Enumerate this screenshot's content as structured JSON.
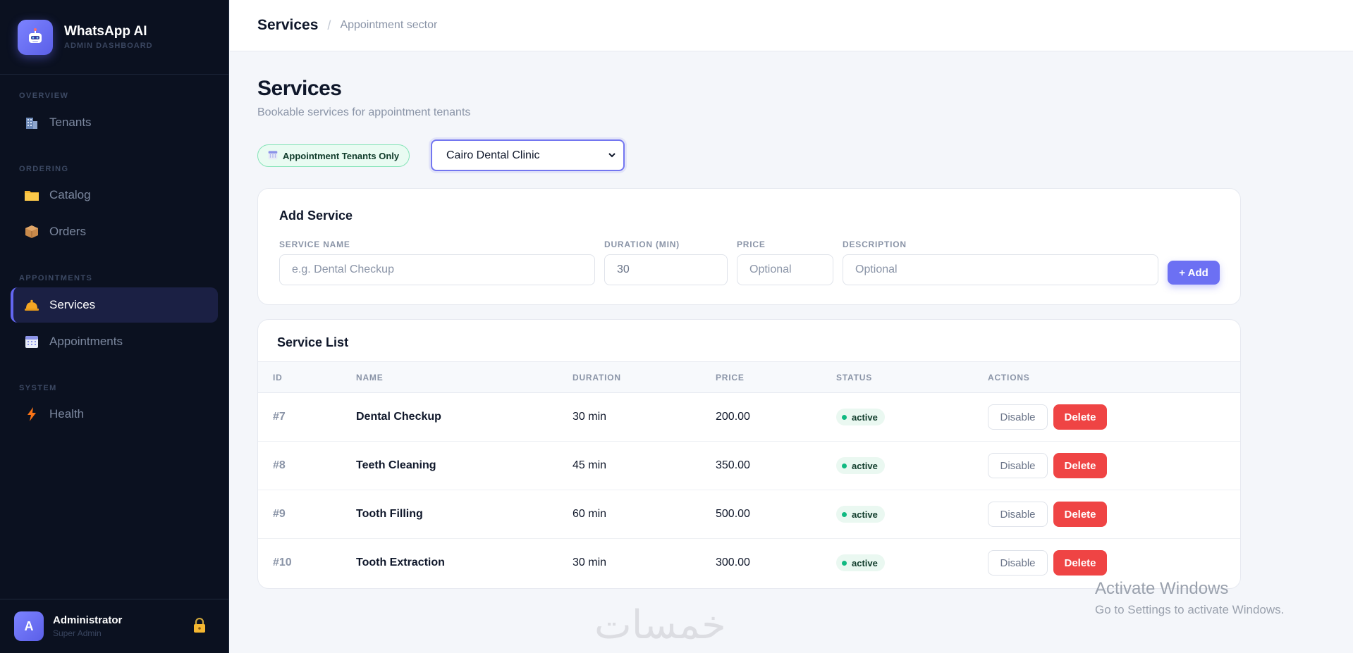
{
  "brand": {
    "title": "WhatsApp AI",
    "subtitle": "ADMIN DASHBOARD"
  },
  "nav": {
    "sections": [
      {
        "label": "OVERVIEW"
      },
      {
        "label": "ORDERING"
      },
      {
        "label": "APPOINTMENTS"
      },
      {
        "label": "SYSTEM"
      }
    ],
    "items": [
      {
        "label": "Tenants",
        "icon": "building-icon"
      },
      {
        "label": "Catalog",
        "icon": "folder-icon"
      },
      {
        "label": "Orders",
        "icon": "package-icon"
      },
      {
        "label": "Services",
        "icon": "bell-icon",
        "active": true
      },
      {
        "label": "Appointments",
        "icon": "calendar-icon"
      },
      {
        "label": "Health",
        "icon": "lightning-icon"
      }
    ]
  },
  "user": {
    "initial": "A",
    "name": "Administrator",
    "role": "Super Admin"
  },
  "breadcrumb": {
    "main": "Services",
    "separator": "/",
    "sub": "Appointment sector"
  },
  "page": {
    "title": "Services",
    "subtitle": "Bookable services for appointment tenants"
  },
  "filter": {
    "badge": "Appointment Tenants Only",
    "tenant_selected": "Cairo Dental Clinic"
  },
  "add_form": {
    "title": "Add Service",
    "name_label": "SERVICE NAME",
    "name_placeholder": "e.g. Dental Checkup",
    "duration_label": "DURATION (MIN)",
    "duration_value": "30",
    "price_label": "PRICE",
    "price_placeholder": "Optional",
    "desc_label": "DESCRIPTION",
    "desc_placeholder": "Optional",
    "add_button": "+ Add"
  },
  "service_list": {
    "title": "Service List",
    "columns": [
      "ID",
      "NAME",
      "DURATION",
      "PRICE",
      "STATUS",
      "ACTIONS"
    ],
    "rows": [
      {
        "id": "#7",
        "name": "Dental Checkup",
        "duration": "30 min",
        "price": "200.00",
        "status": "active"
      },
      {
        "id": "#8",
        "name": "Teeth Cleaning",
        "duration": "45 min",
        "price": "350.00",
        "status": "active"
      },
      {
        "id": "#9",
        "name": "Tooth Filling",
        "duration": "60 min",
        "price": "500.00",
        "status": "active"
      },
      {
        "id": "#10",
        "name": "Tooth Extraction",
        "duration": "30 min",
        "price": "300.00",
        "status": "active"
      }
    ],
    "disable_label": "Disable",
    "delete_label": "Delete"
  },
  "watermark": "خمسات",
  "windows_notice": {
    "title": "Activate Windows",
    "subtitle": "Go to Settings to activate Windows."
  },
  "colors": {
    "accent": "#6366f1",
    "danger": "#ef4444",
    "success": "#10b981",
    "sidebar_bg": "#0b1120"
  }
}
